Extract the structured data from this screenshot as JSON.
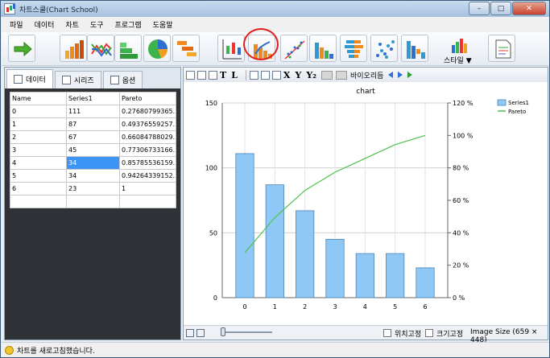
{
  "window": {
    "title": "차트스쿨(Chart School)",
    "buttons": {
      "minimize": "–",
      "maximize": "□",
      "close": "✕"
    }
  },
  "menu": [
    "파일",
    "데이터",
    "차트",
    "도구",
    "프로그램",
    "도움말"
  ],
  "toolbar": {
    "buttons": [
      "arrow-right-icon",
      "bar-chart-icon",
      "line-chart-icon",
      "step-chart-icon",
      "pie-chart-icon",
      "gantt-chart-icon",
      "candle-chart-icon",
      "pareto-chart-icon",
      "scatter-line-icon",
      "column-chart-icon",
      "pyramid-chart-icon",
      "bubble-chart-icon",
      "mixed-chart-icon"
    ],
    "style_label": "스타일 ▼",
    "selected": "pareto-chart-icon"
  },
  "left_panel": {
    "tabs": [
      "데이터",
      "시리즈",
      "옵션"
    ],
    "table": {
      "headers": [
        "Name",
        "Series1",
        "Pareto"
      ],
      "rows": [
        [
          "0",
          "111",
          "0.27680799365..."
        ],
        [
          "1",
          "87",
          "0.49376559257..."
        ],
        [
          "2",
          "67",
          "0.66084788029..."
        ],
        [
          "3",
          "45",
          "0.77306733166..."
        ],
        [
          "4",
          "34",
          "0.85785536159..."
        ],
        [
          "5",
          "34",
          "0.94264339152..."
        ],
        [
          "6",
          "23",
          "1"
        ]
      ],
      "selected_cell": [
        4,
        1
      ]
    }
  },
  "right_toolbar": {
    "labels": [
      "T",
      "L",
      "X",
      "Y",
      "Y₂"
    ],
    "sort_label": "바이오리듬"
  },
  "chart_data": {
    "type": "bar",
    "title": "chart",
    "categories": [
      "0",
      "1",
      "2",
      "3",
      "4",
      "5",
      "6"
    ],
    "series": [
      {
        "name": "Series1",
        "type": "bar",
        "axis": "left",
        "color": "#8fc8f4",
        "values": [
          111,
          87,
          67,
          45,
          34,
          34,
          23
        ]
      },
      {
        "name": "Pareto",
        "type": "line",
        "axis": "right",
        "color": "#4cc24c",
        "values": [
          27.7,
          49.4,
          66.1,
          77.3,
          85.8,
          94.3,
          100
        ]
      }
    ],
    "ylim": [
      0,
      150
    ],
    "y_ticks": [
      "0",
      "50",
      "100",
      "150"
    ],
    "y2lim": [
      0,
      120
    ],
    "y2_ticks": [
      "0 %",
      "20 %",
      "40 %",
      "60 %",
      "80 %",
      "100 %",
      "120 %"
    ],
    "grid": true,
    "legend": "top-right"
  },
  "bottom": {
    "fix_position": "위치고정",
    "fix_size": "크기고정",
    "image_size": "Image Size (659 × 448)"
  },
  "status": "차트를 새로고침했습니다."
}
